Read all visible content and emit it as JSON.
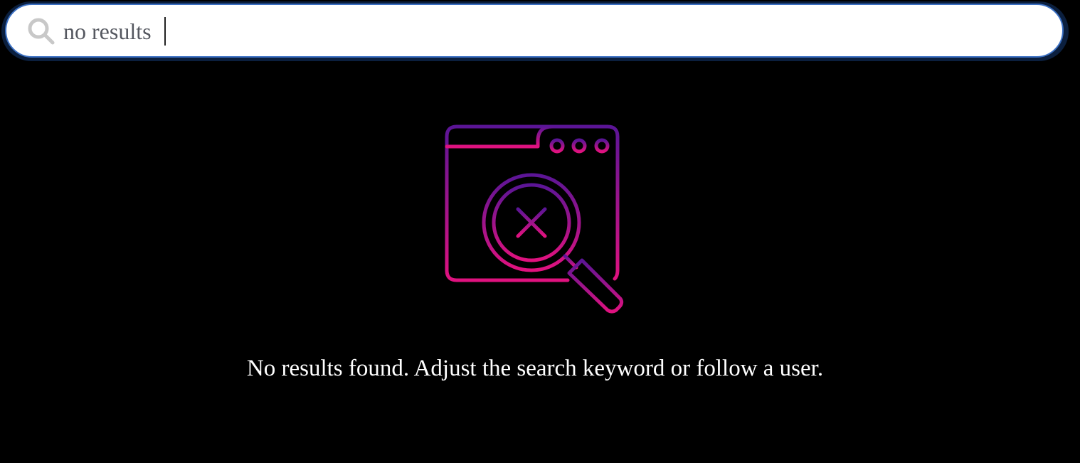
{
  "search": {
    "value": "no results",
    "icon": "search-icon"
  },
  "empty_state": {
    "icon": "browser-search-no-results-icon",
    "gradient_top": "#5b1596",
    "gradient_bottom": "#e0127f",
    "message": "No results found. Adjust the search keyword or follow a user."
  },
  "colors": {
    "background": "#000000",
    "search_border": "#3a6fc2",
    "search_outer": "#0b1f3e",
    "message_text": "#ffffff"
  }
}
